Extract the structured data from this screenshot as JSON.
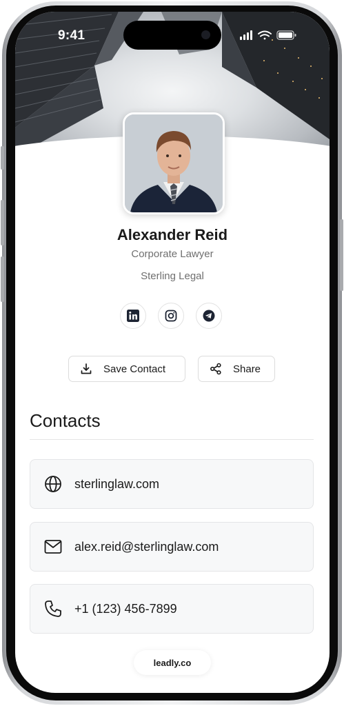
{
  "status_bar": {
    "time": "9:41"
  },
  "profile": {
    "name": "Alexander Reid",
    "title": "Corporate Lawyer",
    "company": "Sterling Legal"
  },
  "social": [
    {
      "icon": "linkedin-icon"
    },
    {
      "icon": "instagram-icon"
    },
    {
      "icon": "telegram-icon"
    }
  ],
  "actions": {
    "save_label": "Save Contact",
    "share_label": "Share"
  },
  "contacts": {
    "heading": "Contacts",
    "items": [
      {
        "icon": "globe-icon",
        "value": "sterlinglaw.com"
      },
      {
        "icon": "mail-icon",
        "value": "alex.reid@sterlinglaw.com"
      },
      {
        "icon": "phone-icon",
        "value": "+1 (123) 456-7899"
      }
    ]
  },
  "footer": {
    "brand": "leadly.co"
  },
  "colors": {
    "text": "#1a1a1a",
    "muted": "#6f6f6f",
    "card_bg": "#f7f8f9",
    "icon_dark": "#1d2433"
  }
}
